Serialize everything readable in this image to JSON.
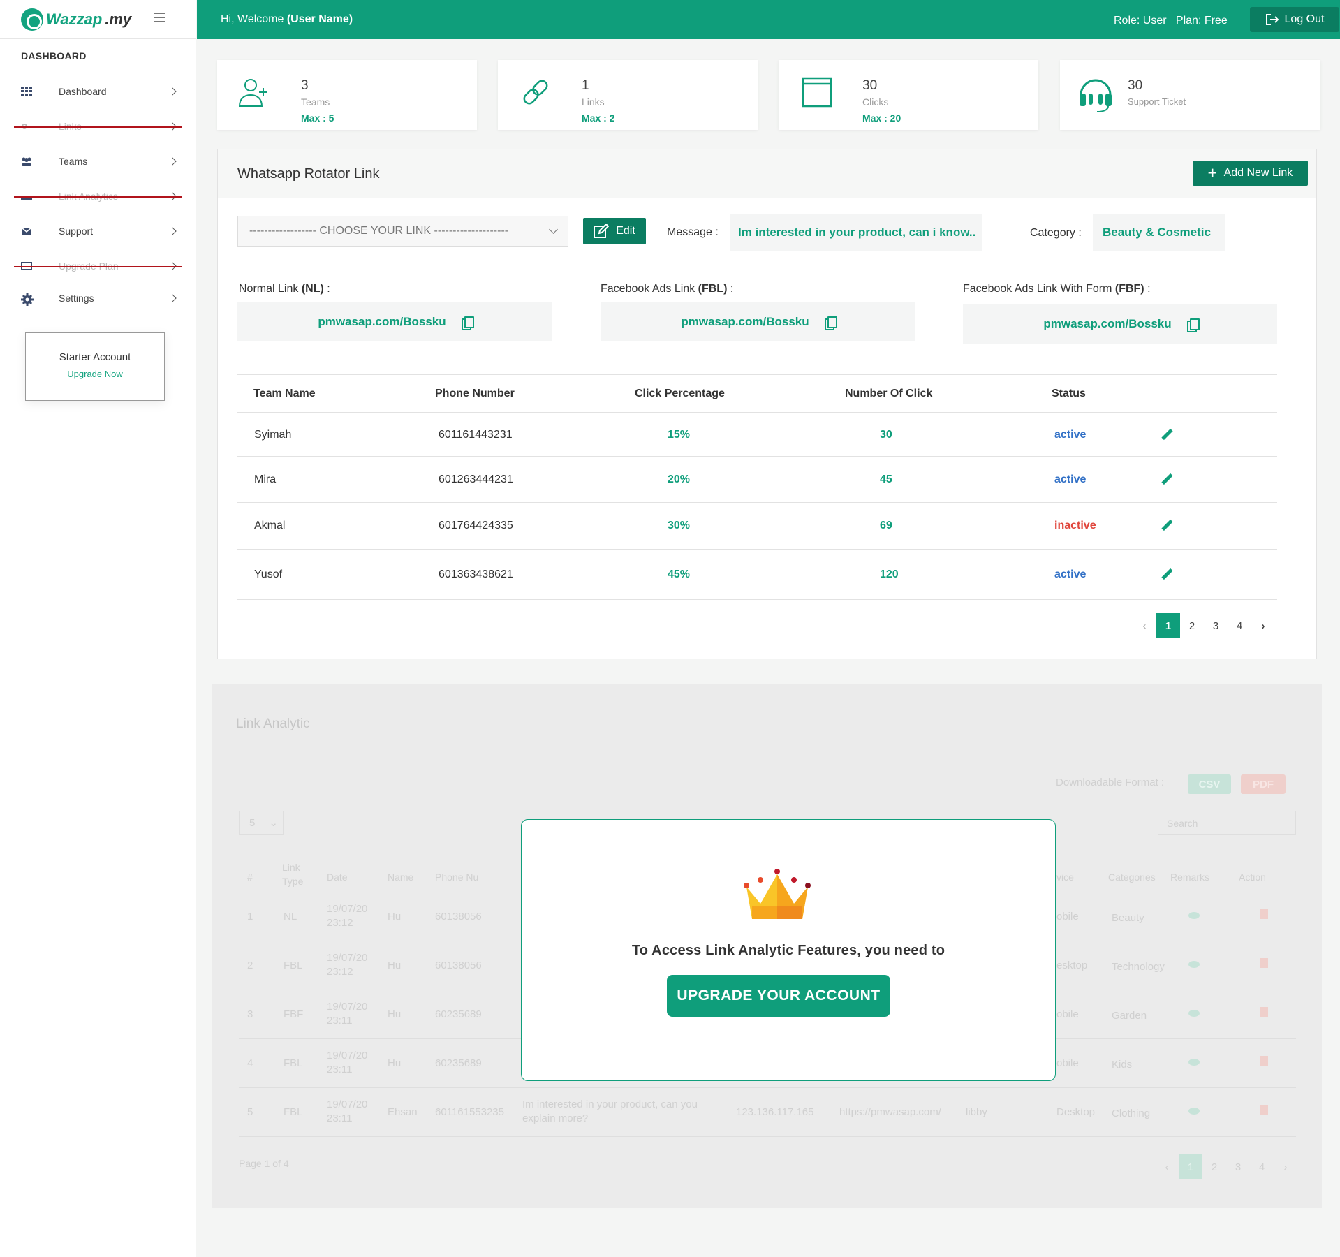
{
  "brand": {
    "logo_text_a": "Wazzap",
    "logo_text_b": ".my"
  },
  "sidebar": {
    "heading": "DASHBOARD",
    "items": [
      {
        "label": "Dashboard",
        "icon": "grid-icon",
        "disabled": false
      },
      {
        "label": "Links",
        "icon": "link-icon",
        "disabled": true
      },
      {
        "label": "Teams",
        "icon": "users-icon",
        "disabled": false
      },
      {
        "label": "Link Analytics",
        "icon": "chart-icon",
        "disabled": true
      },
      {
        "label": "Support",
        "icon": "envelope-icon",
        "disabled": false
      },
      {
        "label": "Upgrade Plan",
        "icon": "card-icon",
        "disabled": true
      },
      {
        "label": "Settings",
        "icon": "gear-icon",
        "disabled": false
      }
    ],
    "starter": {
      "title": "Starter Account",
      "link": "Upgrade Now"
    }
  },
  "topbar": {
    "welcome_prefix": "Hi, Welcome",
    "user": "(User Name)",
    "role_plan": "Role: User   Plan: Free",
    "logout": "Log Out"
  },
  "stats": [
    {
      "value": "3",
      "label": "Teams",
      "max": "Max : 5",
      "icon": "add-user-icon"
    },
    {
      "value": "1",
      "label": "Links",
      "max": "Max : 2",
      "icon": "link-icon"
    },
    {
      "value": "30",
      "label": "Clicks",
      "max": "Max : 20",
      "icon": "browser-window-icon"
    },
    {
      "value": "30",
      "label": "Support Ticket",
      "max": "",
      "icon": "headset-icon"
    }
  ],
  "rotator": {
    "title": "Whatsapp Rotator Link",
    "add_button": "Add New Link",
    "chooser_placeholder": "------------------ CHOOSE YOUR LINK --------------------",
    "edit": "Edit",
    "message_label": "Message :",
    "message_value": "Im interested in your product, can i know..",
    "category_label": "Category :",
    "category_value": "Beauty & Cosmetic",
    "links": [
      {
        "label_a": "Normal Link ",
        "label_b": "(NL)",
        "label_c": " :",
        "url": "pmwasap.com/Bossku"
      },
      {
        "label_a": "Facebook Ads Link ",
        "label_b": "(FBL)",
        "label_c": " :",
        "url": "pmwasap.com/Bossku"
      },
      {
        "label_a": "Facebook Ads Link With Form ",
        "label_b": "(FBF)",
        "label_c": " :",
        "url": "pmwasap.com/Bossku"
      }
    ],
    "columns": [
      "Team Name",
      "Phone Number",
      "Click Percentage",
      "Number Of Click",
      "Status"
    ],
    "rows": [
      {
        "name": "Syimah",
        "phone": "601161443231",
        "pct": "15%",
        "clicks": "30",
        "status": "active"
      },
      {
        "name": "Mira",
        "phone": "601263444231",
        "pct": "20%",
        "clicks": "45",
        "status": "active"
      },
      {
        "name": "Akmal",
        "phone": "601764424335",
        "pct": "30%",
        "clicks": "69",
        "status": "inactive"
      },
      {
        "name": "Yusof",
        "phone": "601363438621",
        "pct": "45%",
        "clicks": "120",
        "status": "active"
      }
    ],
    "pages": [
      "1",
      "2",
      "3",
      "4"
    ]
  },
  "analytic": {
    "title": "Link Analytic",
    "download_label": "Downloadable Format :",
    "csv": "CSV",
    "pdf": "PDF",
    "page_size": "5",
    "search_placeholder": "Search",
    "columns": [
      "#",
      "Link Type",
      "Date",
      "Name",
      "Phone Nu",
      "vice",
      "Categories",
      "Remarks",
      "Action"
    ],
    "rows": [
      {
        "n": "1",
        "type": "NL",
        "date": "19/07/20 23:12",
        "name": "Hu",
        "phone": "60138056",
        "device": "obile",
        "cat": "Beauty"
      },
      {
        "n": "2",
        "type": "FBL",
        "date": "19/07/20 23:12",
        "name": "Hu",
        "phone": "60138056",
        "device": "esktop",
        "cat": "Technology"
      },
      {
        "n": "3",
        "type": "FBF",
        "date": "19/07/20 23:11",
        "name": "Hu",
        "phone": "60235689",
        "device": "obile",
        "cat": "Garden"
      },
      {
        "n": "4",
        "type": "FBL",
        "date": "19/07/20 23:11",
        "name": "Hu",
        "phone": "60235689",
        "device": "obile",
        "cat": "Kids"
      },
      {
        "n": "5",
        "type": "FBL",
        "date": "19/07/20 23:11",
        "name": "Ehsan",
        "phone": "601161553235",
        "msg": "Im interested in your product, can you explain more?",
        "ip": "123.136.117.165",
        "url": "https://pmwasap.com/",
        "user": "libby",
        "device": "Desktop",
        "cat": "Clothing"
      }
    ],
    "page_info": "Page 1 of 4",
    "pages": [
      "1",
      "2",
      "3",
      "4"
    ]
  },
  "modal": {
    "text": "To Access Link Analytic Features, you need to",
    "button": "UPGRADE YOUR ACCOUNT",
    "icon": "crown-icon"
  },
  "colors": {
    "primary": "#0f9e7b",
    "dark_primary": "#0b7d61",
    "active": "#3170c6",
    "inactive": "#e0463c",
    "strike": "#b1141c"
  }
}
